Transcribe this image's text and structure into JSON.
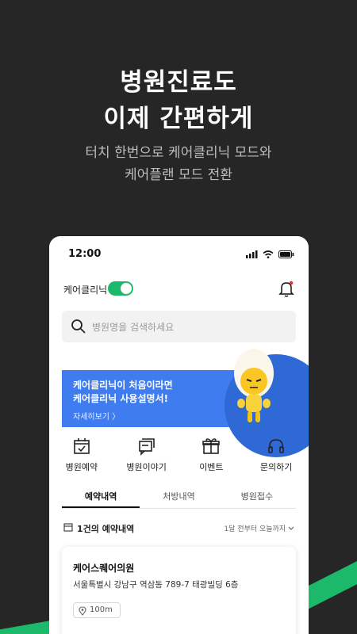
{
  "hero": {
    "title_line1": "병원진료도",
    "title_line2": "이제 간편하게",
    "sub_line1": "터치 한번으로 케어클리닉 모드와",
    "sub_line2": "케어플랜 모드 전환"
  },
  "phone": {
    "status_time": "12:00",
    "toggle_label": "케어클리닉",
    "toggle_on": true,
    "search_placeholder": "병원명을 검색하세요",
    "banner": {
      "line1": "케어클리닉이 처음이라면",
      "line2": "케어클리닉 사용설명서!",
      "more": "자세히보기 〉"
    },
    "menu": [
      {
        "label": "병원예약",
        "icon": "calendar-check-icon"
      },
      {
        "label": "병원이야기",
        "icon": "chat-bubble-icon"
      },
      {
        "label": "이벤트",
        "icon": "gift-icon"
      },
      {
        "label": "문의하기",
        "icon": "headset-icon"
      }
    ],
    "tabs": [
      "예약내역",
      "처방내역",
      "병원접수"
    ],
    "active_tab": 0,
    "count_text": "1건의 예약내역",
    "filter_text": "1달 전부터 오늘까지",
    "card": {
      "name": "케어스퀘어의원",
      "address": "서울특별시 강남구 역삼동 789-7 태광빌딩 6층",
      "distance": "100m"
    }
  },
  "colors": {
    "background": "#262626",
    "accent_green": "#1db96a",
    "banner_blue": "#3e7cf0"
  }
}
